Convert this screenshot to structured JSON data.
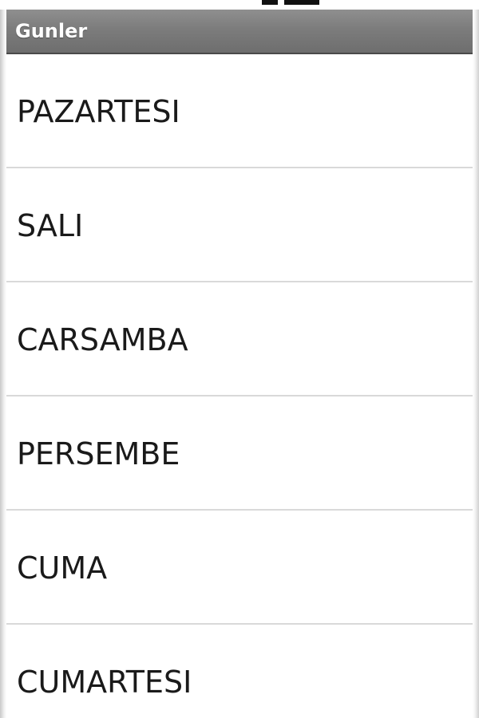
{
  "title_bar": {
    "title": "Gunler"
  },
  "days": {
    "items": [
      {
        "label": "PAZARTESI"
      },
      {
        "label": "SALI"
      },
      {
        "label": "CARSAMBA"
      },
      {
        "label": "PERSEMBE"
      },
      {
        "label": "CUMA"
      },
      {
        "label": "CUMARTESI"
      }
    ]
  }
}
